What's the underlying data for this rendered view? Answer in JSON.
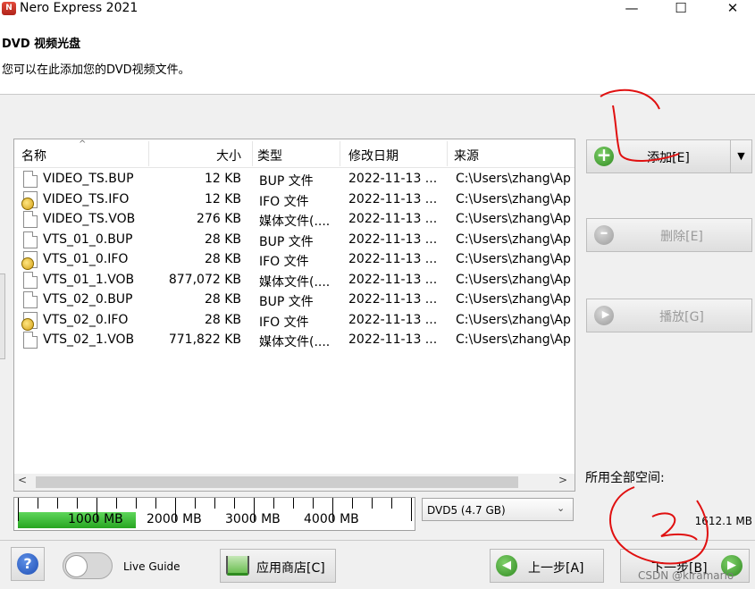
{
  "window": {
    "title": "Nero Express 2021",
    "app_icon_text": "N",
    "min_glyph": "—",
    "max_glyph": "☐",
    "close_glyph": "✕"
  },
  "header": {
    "title": "DVD 视频光盘",
    "subtitle": "您可以在此添加您的DVD视频文件。"
  },
  "file_list": {
    "sort_arrow": "^",
    "columns": [
      "名称",
      "大小",
      "类型",
      "修改日期",
      "来源"
    ],
    "rows": [
      {
        "icon": "document-icon",
        "name": "VIDEO_TS.BUP",
        "size": "12 KB",
        "type": "BUP 文件",
        "date": "2022-11-13 ...",
        "source": "C:\\Users\\zhang\\Ap"
      },
      {
        "icon": "info-file-icon",
        "name": "VIDEO_TS.IFO",
        "size": "12 KB",
        "type": "IFO 文件",
        "date": "2022-11-13 ...",
        "source": "C:\\Users\\zhang\\Ap"
      },
      {
        "icon": "document-icon",
        "name": "VIDEO_TS.VOB",
        "size": "276 KB",
        "type": "媒体文件(....",
        "date": "2022-11-13 ...",
        "source": "C:\\Users\\zhang\\Ap"
      },
      {
        "icon": "document-icon",
        "name": "VTS_01_0.BUP",
        "size": "28 KB",
        "type": "BUP 文件",
        "date": "2022-11-13 ...",
        "source": "C:\\Users\\zhang\\Ap"
      },
      {
        "icon": "info-file-icon",
        "name": "VTS_01_0.IFO",
        "size": "28 KB",
        "type": "IFO 文件",
        "date": "2022-11-13 ...",
        "source": "C:\\Users\\zhang\\Ap"
      },
      {
        "icon": "document-icon",
        "name": "VTS_01_1.VOB",
        "size": "877,072 KB",
        "type": "媒体文件(....",
        "date": "2022-11-13 ...",
        "source": "C:\\Users\\zhang\\Ap"
      },
      {
        "icon": "document-icon",
        "name": "VTS_02_0.BUP",
        "size": "28 KB",
        "type": "BUP 文件",
        "date": "2022-11-13 ...",
        "source": "C:\\Users\\zhang\\Ap"
      },
      {
        "icon": "info-file-icon",
        "name": "VTS_02_0.IFO",
        "size": "28 KB",
        "type": "IFO 文件",
        "date": "2022-11-13 ...",
        "source": "C:\\Users\\zhang\\Ap"
      },
      {
        "icon": "document-icon",
        "name": "VTS_02_1.VOB",
        "size": "771,822 KB",
        "type": "媒体文件(....",
        "date": "2022-11-13 ...",
        "source": "C:\\Users\\zhang\\Ap"
      }
    ],
    "scroll_left": "<",
    "scroll_right": ">"
  },
  "side_buttons": {
    "add_label": "添加[E]",
    "add_dropdown_glyph": "▼",
    "delete_label": "删除[E]",
    "play_label": "播放[G]"
  },
  "space": {
    "label": "所用全部空间:",
    "value": "1612.1 MB",
    "used_fraction_of_scale": 0.3
  },
  "capacity_bar": {
    "labels": [
      "1000 MB",
      "2000 MB",
      "3000 MB",
      "4000 MB"
    ]
  },
  "disc_select": {
    "value": "DVD5 (4.7 GB)",
    "arrow": "⌄"
  },
  "footer": {
    "help_glyph": "?",
    "live_guide": "Live Guide",
    "store_label": "应用商店[C]",
    "back_label": "上一步[A]",
    "back_glyph": "◀",
    "next_label": "下一步[B]",
    "next_glyph": "▶"
  },
  "watermark": {
    "csdn": "CSDN @kiramario"
  },
  "colors": {
    "capacity_fill": "#27a521",
    "annotation": "#e01010"
  }
}
